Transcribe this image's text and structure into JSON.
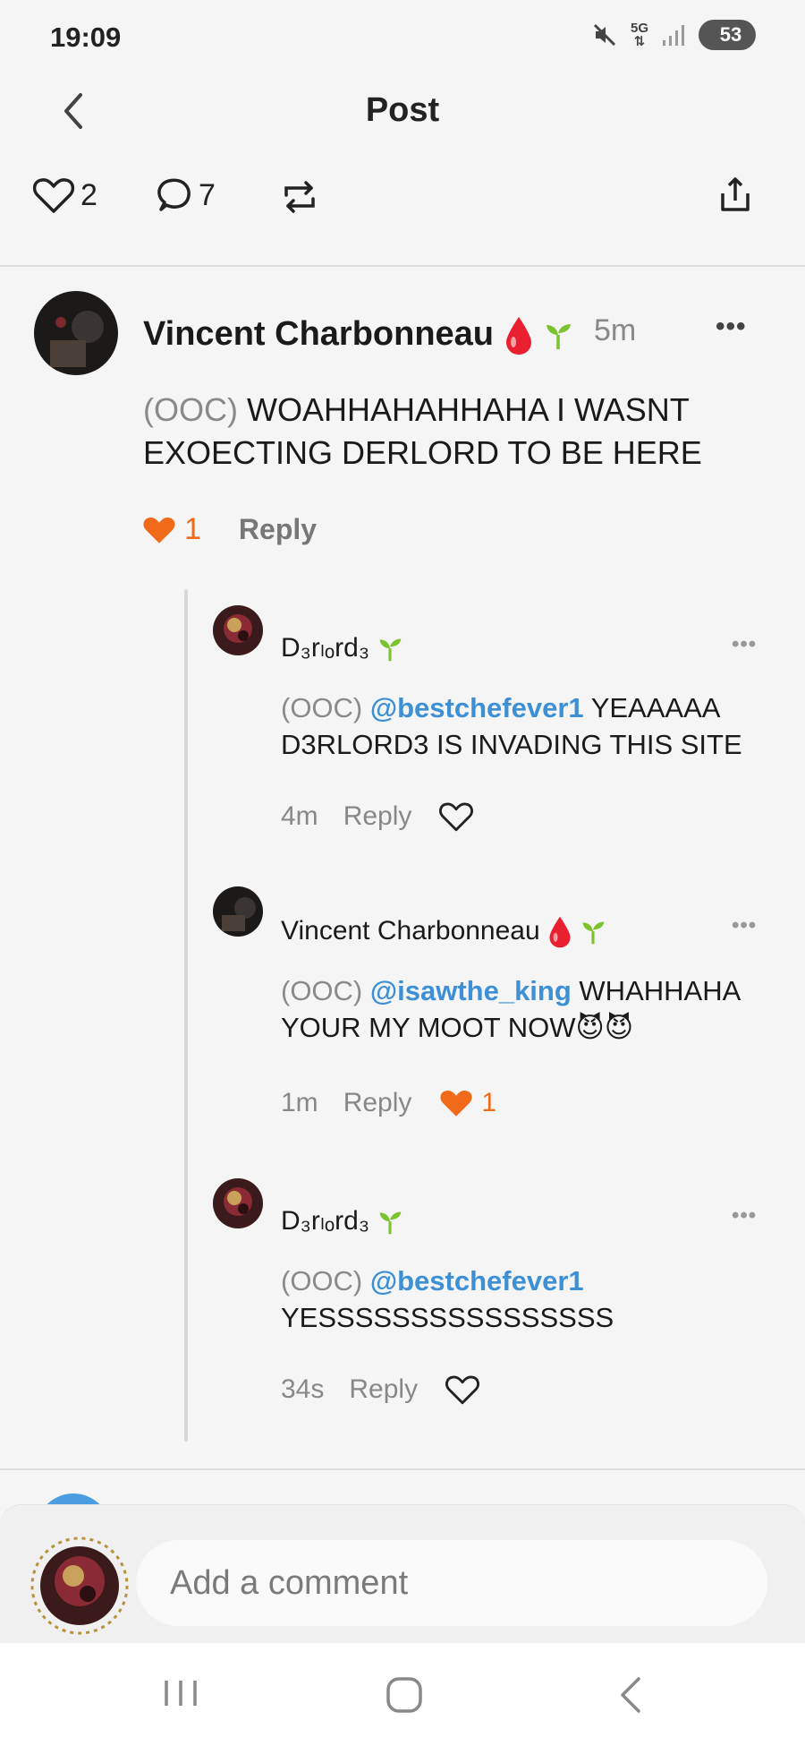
{
  "status": {
    "time": "19:09",
    "battery": "53",
    "network": "5G"
  },
  "header": {
    "title": "Post"
  },
  "actions": {
    "likes": "2",
    "comments": "7"
  },
  "main_comment": {
    "author": "Vincent Charbonneau",
    "time": "5m",
    "ooc": "(OOC)",
    "text": "WOAHHAHAHHAHA I WASNT EXOECTING DERLORD TO BE HERE",
    "likes": "1",
    "reply": "Reply"
  },
  "replies": [
    {
      "author": "D₃rₗₒr d₃",
      "author_display": "D₃rₗₒrd₃",
      "ooc": "(OOC)",
      "mention": "@bestchefever1",
      "text": "YEAAAAA D3RLORD3 IS INVADING THIS SITE",
      "time": "4m",
      "reply": "Reply",
      "likes": ""
    },
    {
      "author": "Vincent Charbonneau",
      "ooc": "(OOC)",
      "mention": "@isawthe_king",
      "text": "WHAHHAHA YOUR MY MOOT NOW😈😈",
      "time": "1m",
      "reply": "Reply",
      "likes": "1"
    },
    {
      "author_display": "D₃rₗₒrd₃",
      "ooc": "(OOC)",
      "mention": "@bestchefever1",
      "text": "YESSSSSSSSSSSSSSSS",
      "time": "34s",
      "reply": "Reply",
      "likes": ""
    }
  ],
  "composer": {
    "placeholder": "Add a comment"
  },
  "colors": {
    "accent_orange": "#f06a1a",
    "mention_blue": "#3d8fd6",
    "sprout_green": "#7cc12e",
    "drop_red": "#e8202f"
  },
  "icons": [
    "back-icon",
    "heart-icon",
    "comment-icon",
    "repost-icon",
    "share-icon",
    "more-icon",
    "sprout-icon",
    "drop-icon",
    "mute-icon",
    "signal-icon"
  ]
}
